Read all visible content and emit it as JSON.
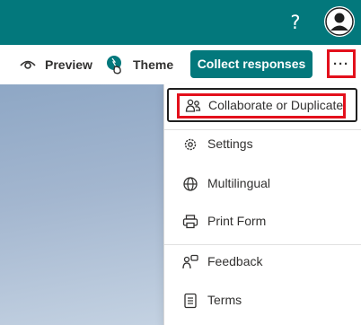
{
  "header": {
    "help_label": "?",
    "avatar_icon": "user-avatar-icon"
  },
  "toolbar": {
    "preview_label": "Preview",
    "theme_label": "Theme",
    "collect_label": "Collect responses",
    "more_label": "···"
  },
  "menu": {
    "items": [
      {
        "label": "Collaborate or Duplicate",
        "icon": "people-icon"
      },
      {
        "label": "Settings",
        "icon": "gear-icon"
      },
      {
        "label": "Multilingual",
        "icon": "globe-icon"
      },
      {
        "label": "Print Form",
        "icon": "printer-icon"
      },
      {
        "label": "Feedback",
        "icon": "feedback-icon"
      },
      {
        "label": "Terms",
        "icon": "document-icon"
      }
    ]
  },
  "colors": {
    "brand": "#03787c",
    "highlight": "#e3101c"
  }
}
